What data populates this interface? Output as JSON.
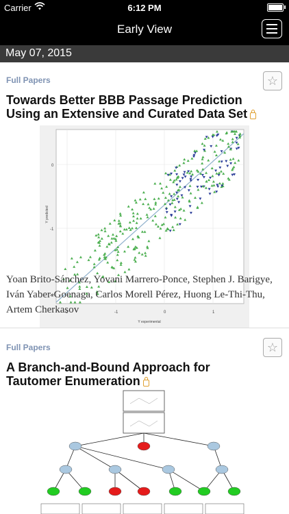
{
  "status": {
    "carrier": "Carrier",
    "time": "6:12 PM"
  },
  "nav": {
    "title": "Early View",
    "menu_icon": "hamburger-menu-icon"
  },
  "date": "May 07, 2015",
  "articles": [
    {
      "category": "Full Papers",
      "title": "Towards Better BBB Passage Prediction Using an Extensive and Curated Data Set",
      "authors": "Yoan Brito-Sánchez, Yovani Marrero-Ponce, Stephen J. Barigye, Iván Yaber-Goenaga, Carlos Morell Pérez, Huong Le-Thi-Thu, Artem Cherkasov",
      "figure": {
        "xlabel": "Y experimental",
        "ylabel": "Y predicted",
        "xticks": [
          "-2",
          "-1",
          "0",
          "1"
        ],
        "yticks": [
          "0",
          "-1",
          "-2"
        ]
      }
    },
    {
      "category": "Full Papers",
      "title": "A Branch-and-Bound Approach for Tautomer Enumeration"
    }
  ],
  "colors": {
    "green": "#4caf50",
    "blue": "#2c3e99",
    "red": "#e51b1b",
    "node_blue": "#aac8e0",
    "node_green": "#22cc22"
  }
}
